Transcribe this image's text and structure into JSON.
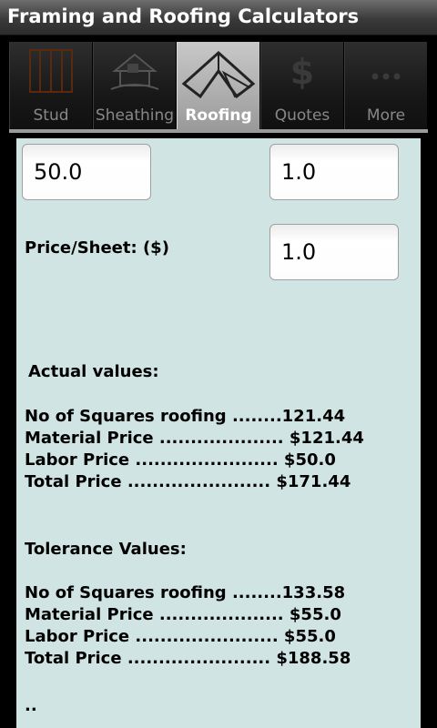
{
  "app": {
    "title": "Framing and Roofing Calculators"
  },
  "tabs": [
    {
      "label": "Stud",
      "icon": "stud-icon"
    },
    {
      "label": "Sheathing",
      "icon": "house-icon"
    },
    {
      "label": "Roofing",
      "icon": "roof-icon",
      "active": true
    },
    {
      "label": "Quotes",
      "icon": "dollar-icon"
    },
    {
      "label": "More",
      "icon": "more-icon"
    }
  ],
  "form": {
    "field_left_value": "50.0",
    "field_right_value": "1.0",
    "price_sheet_label": "Price/Sheet: ($)",
    "price_sheet_value": "1.0"
  },
  "results": {
    "actual_header": "Actual values:",
    "actual": [
      "No of Squares roofing ........121.44",
      "Material Price .................... $121.44",
      "Labor Price ....................... $50.0",
      "Total Price ....................... $171.44"
    ],
    "tolerance_header": "Tolerance Values:",
    "tolerance": [
      "No of Squares roofing ........133.58",
      "Material Price .................... $55.0",
      "Labor Price ....................... $55.0",
      "Total Price ....................... $188.58"
    ],
    "trailing": ".."
  }
}
